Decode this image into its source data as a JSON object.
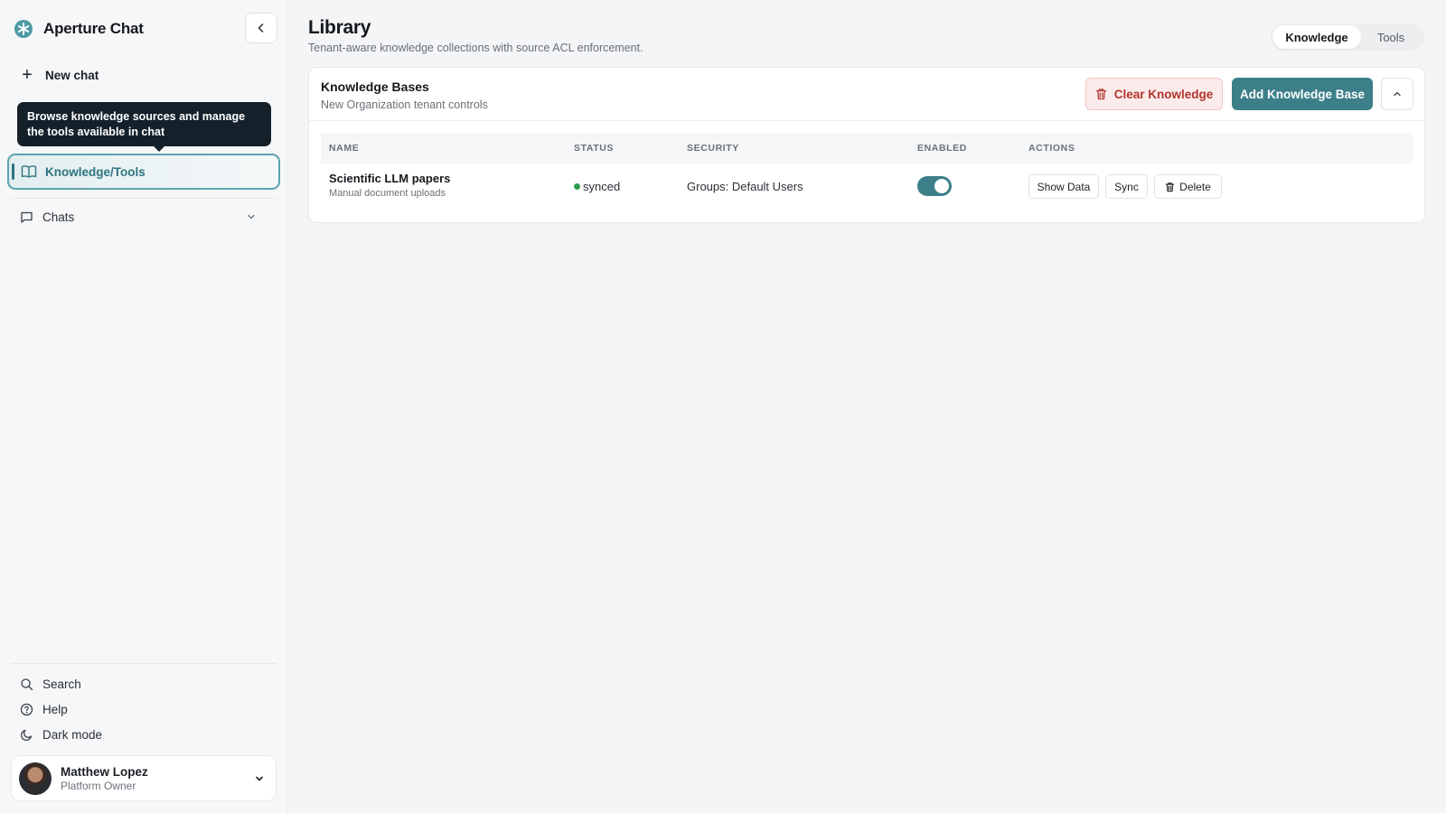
{
  "app": {
    "title": "Aperture Chat"
  },
  "sidebar": {
    "new_chat": "New chat",
    "tooltip": "Browse knowledge sources and manage the tools available in chat",
    "active_item": "Knowledge/Tools",
    "chats": "Chats",
    "bottom": {
      "search": "Search",
      "help": "Help",
      "dark_mode": "Dark mode"
    },
    "user": {
      "name": "Matthew Lopez",
      "role": "Platform Owner"
    }
  },
  "main": {
    "title": "Library",
    "subtitle": "Tenant-aware knowledge collections with source ACL enforcement.",
    "tabs": [
      {
        "label": "Knowledge",
        "active": true
      },
      {
        "label": "Tools",
        "active": false
      }
    ]
  },
  "panel": {
    "title": "Knowledge Bases",
    "subtitle": "New Organization tenant controls",
    "clear_label": "Clear Knowledge",
    "add_label": "Add Knowledge Base",
    "columns": [
      "NAME",
      "STATUS",
      "SECURITY",
      "ENABLED",
      "ACTIONS"
    ],
    "rows": [
      {
        "name": "Scientific LLM papers",
        "source": "Manual document uploads",
        "status": "synced",
        "security": "Groups: Default Users",
        "enabled": true,
        "actions": [
          "Show Data",
          "Sync",
          "Delete"
        ]
      }
    ]
  },
  "colors": {
    "accent": "#3c7f89",
    "danger": "#b2362f",
    "status_ok": "#2f9b4d",
    "tooltip_bg": "#14212b"
  }
}
